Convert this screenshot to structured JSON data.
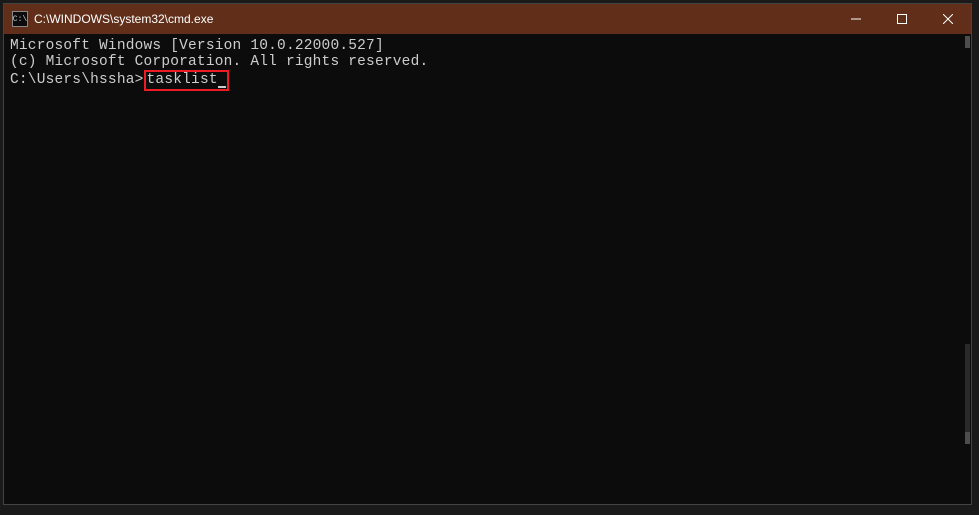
{
  "window": {
    "title": "C:\\WINDOWS\\system32\\cmd.exe",
    "icon_label": "C:\\"
  },
  "terminal": {
    "line1": "Microsoft Windows [Version 10.0.22000.527]",
    "line2": "(c) Microsoft Corporation. All rights reserved.",
    "blank": "",
    "prompt": "C:\\Users\\hssha>",
    "command": "tasklist"
  }
}
